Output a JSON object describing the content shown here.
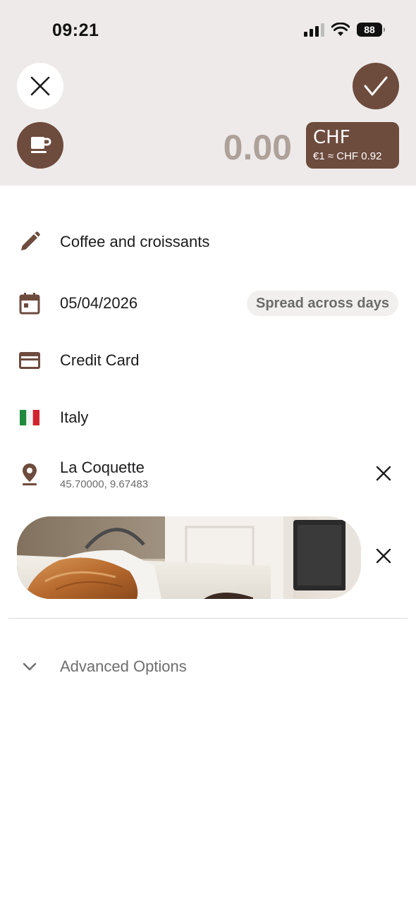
{
  "status_bar": {
    "time": "09:21",
    "battery": "88"
  },
  "header": {
    "close_icon": "close-icon",
    "confirm_icon": "checkmark-icon",
    "category_icon": "coffee-cup-icon",
    "amount": "0.00",
    "currency": {
      "code": "CHF",
      "rate": "€1 ≈ CHF 0.92"
    }
  },
  "form": {
    "description": "Coffee and croissants",
    "date": "05/04/2026",
    "spread_label": "Spread across days",
    "payment_method": "Credit Card",
    "country": "Italy",
    "location": {
      "name": "La Coquette",
      "coordinates": "45.70000, 9.67483"
    },
    "advanced_label": "Advanced Options"
  },
  "colors": {
    "accent": "#6d4b3d",
    "header_bg": "#eeeae9",
    "amount_placeholder": "#aea19a"
  }
}
